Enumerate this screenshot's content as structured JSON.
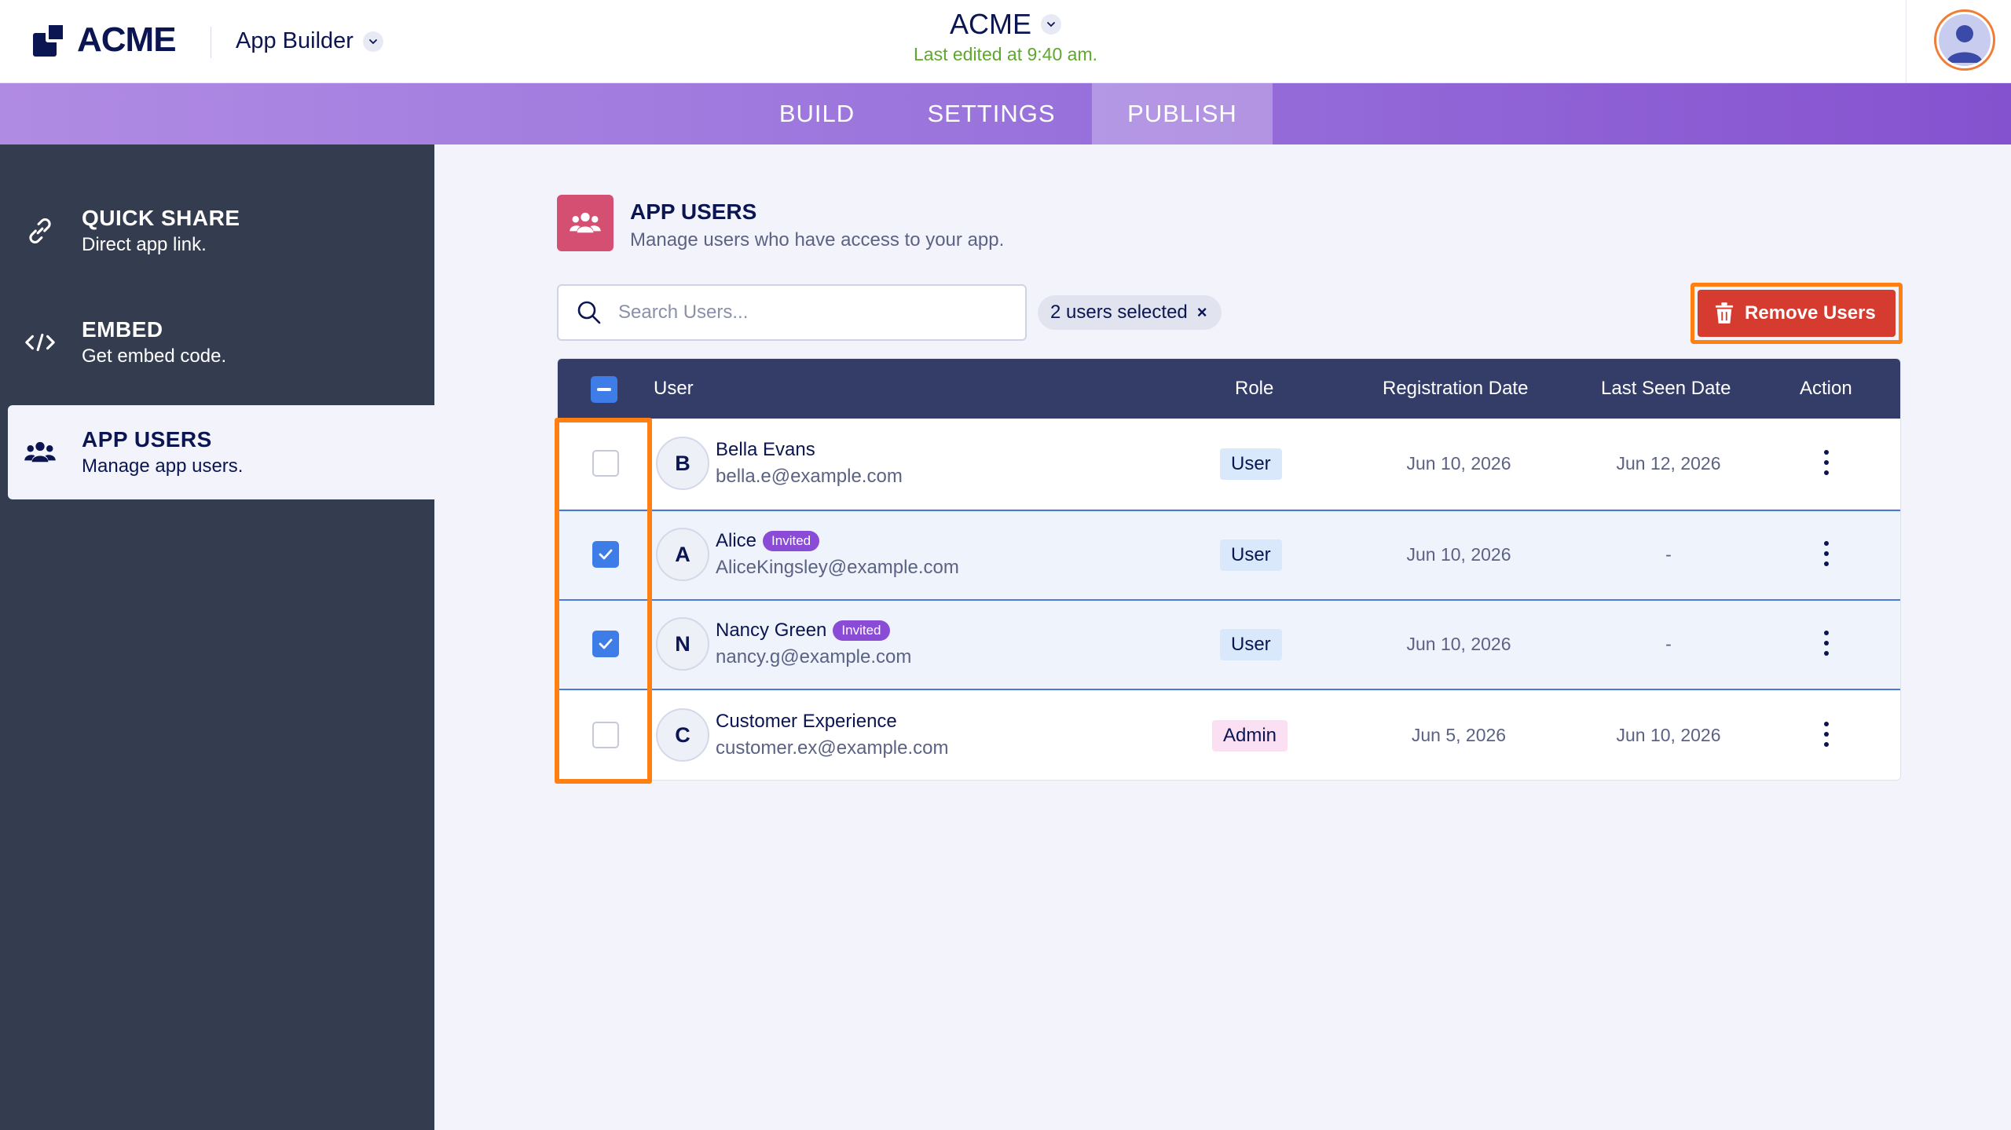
{
  "header": {
    "logo_text": "ACME",
    "builder_label": "App Builder",
    "app_name": "ACME",
    "last_edited": "Last edited at 9:40 am."
  },
  "nav": {
    "tabs": [
      {
        "label": "BUILD"
      },
      {
        "label": "SETTINGS"
      },
      {
        "label": "PUBLISH",
        "active": true
      }
    ]
  },
  "sidebar": {
    "items": [
      {
        "title": "QUICK SHARE",
        "subtitle": "Direct app link.",
        "icon": "link-icon"
      },
      {
        "title": "EMBED",
        "subtitle": "Get embed code.",
        "icon": "code-icon"
      },
      {
        "title": "APP USERS",
        "subtitle": "Manage app users.",
        "icon": "users-icon",
        "active": true
      }
    ]
  },
  "main": {
    "title": "APP USERS",
    "subtitle": "Manage users who have access to your app.",
    "search_placeholder": "Search Users...",
    "selection_chip": "2 users selected",
    "chip_close": "×",
    "remove_button": "Remove Users",
    "table": {
      "columns": [
        "User",
        "Role",
        "Registration Date",
        "Last Seen Date",
        "Action"
      ],
      "rows": [
        {
          "initial": "B",
          "name": "Bella Evans",
          "email": "bella.e@example.com",
          "badge": "",
          "role": "User",
          "registered": "Jun 10, 2026",
          "last_seen": "Jun 12, 2026",
          "selected": false
        },
        {
          "initial": "A",
          "name": "Alice",
          "email": "AliceKingsley@example.com",
          "badge": "Invited",
          "role": "User",
          "registered": "Jun 10, 2026",
          "last_seen": "-",
          "selected": true
        },
        {
          "initial": "N",
          "name": "Nancy Green",
          "email": "nancy.g@example.com",
          "badge": "Invited",
          "role": "User",
          "registered": "Jun 10, 2026",
          "last_seen": "-",
          "selected": true
        },
        {
          "initial": "C",
          "name": "Customer Experience",
          "email": "customer.ex@example.com",
          "badge": "",
          "role": "Admin",
          "registered": "Jun 5, 2026",
          "last_seen": "Jun 10, 2026",
          "selected": false
        }
      ]
    }
  },
  "colors": {
    "brand_navy": "#0a1551",
    "accent_purple": "#9a73dc",
    "danger_red": "#d63b30",
    "highlight_orange": "#ff7f12",
    "checkbox_blue": "#3e7ce8"
  }
}
